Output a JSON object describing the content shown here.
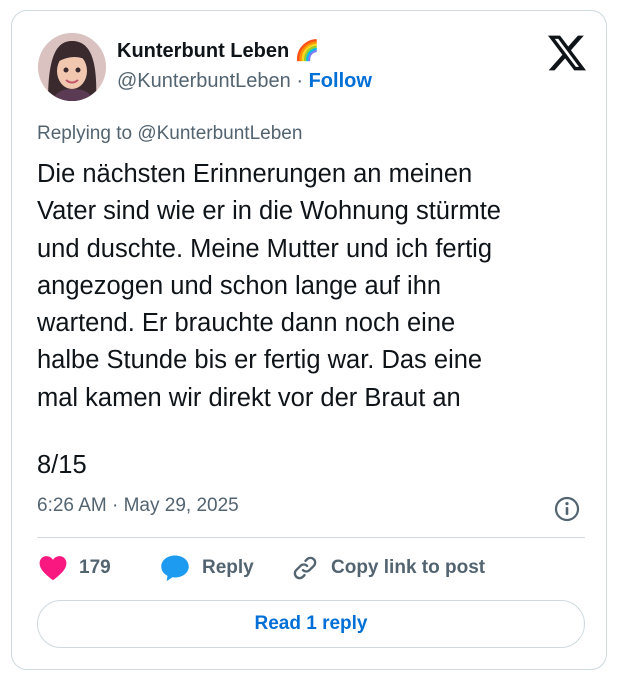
{
  "author": {
    "display_name": "Kunterbunt Leben 🌈",
    "handle": "@KunterbuntLeben",
    "separator": "·",
    "follow_label": "Follow"
  },
  "replying_to": "Replying to @KunterbuntLeben",
  "tweet": {
    "text_lines": [
      "Die nächsten Erinnerungen an meinen",
      "Vater sind wie er in die Wohnung stürmte",
      "und duschte. Meine Mutter und ich fertig",
      "angezogen und schon lange auf ihn",
      "wartend. Er brauchte dann noch eine",
      "halbe Stunde bis er fertig war. Das eine",
      "mal kamen wir direkt vor der Braut an"
    ],
    "counter": "8/15",
    "timestamp": "6:26 AM · May 29, 2025"
  },
  "actions": {
    "likes": "179",
    "reply_label": "Reply",
    "copy_link_label": "Copy link to post"
  },
  "read_reply_label": "Read 1 reply",
  "icons": {
    "brand": "x-logo-icon",
    "info": "info-icon",
    "like": "heart-icon",
    "reply": "speech-bubble-icon",
    "copy": "link-icon"
  },
  "colors": {
    "link_blue": "#006fd6",
    "heart": "#f91880",
    "reply_bubble": "#1d9bf0",
    "muted_text": "#536471",
    "border": "#cfd9de"
  }
}
